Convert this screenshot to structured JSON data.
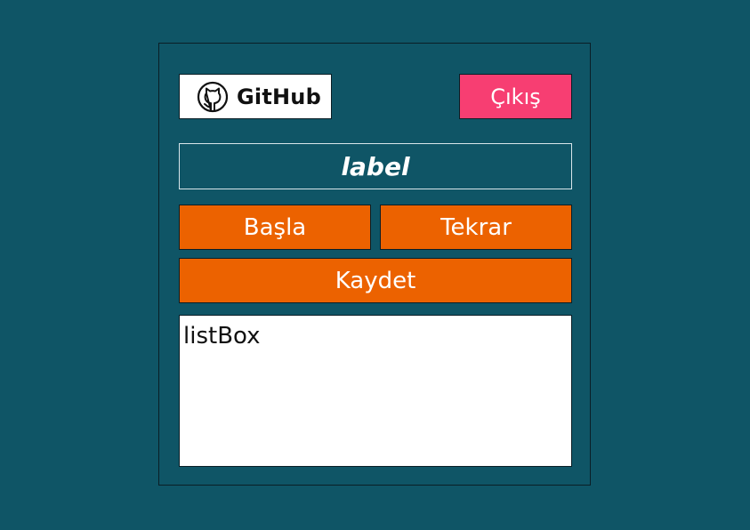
{
  "github_button": {
    "label": "GitHub",
    "icon": "github-icon"
  },
  "exit_button": {
    "label": "Çıkış",
    "color": "#f73e72"
  },
  "status_label": {
    "text": "label"
  },
  "controls": {
    "start_label": "Başla",
    "again_label": "Tekrar",
    "save_label": "Kaydet",
    "color": "#ec6200"
  },
  "listbox": {
    "text": "listBox"
  },
  "colors": {
    "background": "#0f5566"
  }
}
